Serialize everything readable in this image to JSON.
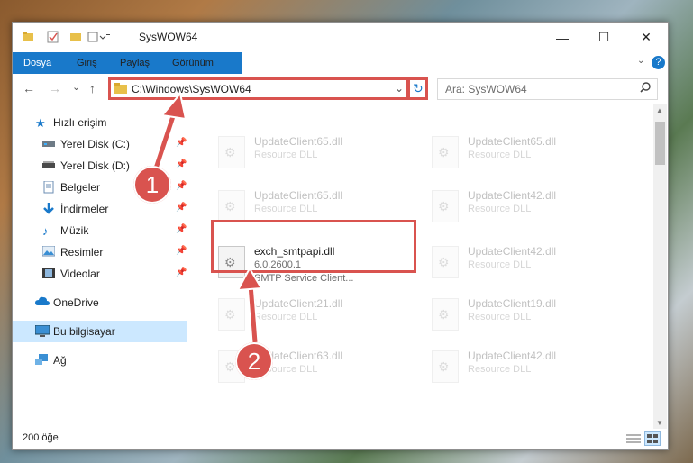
{
  "window": {
    "title": "SysWOW64",
    "minimize": "—",
    "maximize": "☐",
    "close": "✕"
  },
  "ribbon": {
    "tabs": [
      "Dosya",
      "Giriş",
      "Paylaş",
      "Görünüm"
    ],
    "help": "?"
  },
  "address": {
    "path": "C:\\Windows\\SysWOW64",
    "refresh": "↻",
    "dropdown": "⌄"
  },
  "search": {
    "placeholder": "Ara: SysWOW64"
  },
  "nav_buttons": {
    "back": "←",
    "forward": "→",
    "recent": "⌄",
    "up": "↑"
  },
  "sidebar": {
    "items": [
      {
        "label": "Hızlı erişim",
        "icon": "star-icon",
        "pinned": false
      },
      {
        "label": "Yerel Disk (C:)",
        "icon": "drive-icon",
        "pinned": true
      },
      {
        "label": "Yerel Disk (D:)",
        "icon": "drive-icon",
        "pinned": true
      },
      {
        "label": "Belgeler",
        "icon": "documents-icon",
        "pinned": true
      },
      {
        "label": "İndirmeler",
        "icon": "downloads-icon",
        "pinned": true
      },
      {
        "label": "Müzik",
        "icon": "music-icon",
        "pinned": true
      },
      {
        "label": "Resimler",
        "icon": "pictures-icon",
        "pinned": true
      },
      {
        "label": "Videolar",
        "icon": "videos-icon",
        "pinned": true
      },
      {
        "label": "OneDrive",
        "icon": "cloud-icon",
        "pinned": false
      },
      {
        "label": "Bu bilgisayar",
        "icon": "computer-icon",
        "pinned": false
      },
      {
        "label": "Ağ",
        "icon": "network-icon",
        "pinned": false
      }
    ]
  },
  "files": [
    {
      "name": "UpdateClient65.dll",
      "desc": "Resource DLL",
      "extra": ""
    },
    {
      "name": "UpdateClient65.dll",
      "desc": "Resource DLL",
      "extra": ""
    },
    {
      "name": "UpdateClient65.dll",
      "desc": "Resource DLL",
      "extra": ""
    },
    {
      "name": "UpdateClient42.dll",
      "desc": "Resource DLL",
      "extra": ""
    },
    {
      "name": "exch_smtpapi.dll",
      "desc": "6.0.2600.1",
      "extra": "SMTP Service Client..."
    },
    {
      "name": "UpdateClient42.dll",
      "desc": "Resource DLL",
      "extra": ""
    },
    {
      "name": "UpdateClient21.dll",
      "desc": "Resource DLL",
      "extra": ""
    },
    {
      "name": "UpdateClient19.dll",
      "desc": "Resource DLL",
      "extra": ""
    },
    {
      "name": "UpdateClient63.dll",
      "desc": "Resource DLL",
      "extra": ""
    },
    {
      "name": "UpdateClient42.dll",
      "desc": "Resource DLL",
      "extra": ""
    }
  ],
  "status": {
    "count": "200 öğe"
  },
  "annotations": {
    "step1": "1",
    "step2": "2",
    "color": "#d9534f"
  }
}
